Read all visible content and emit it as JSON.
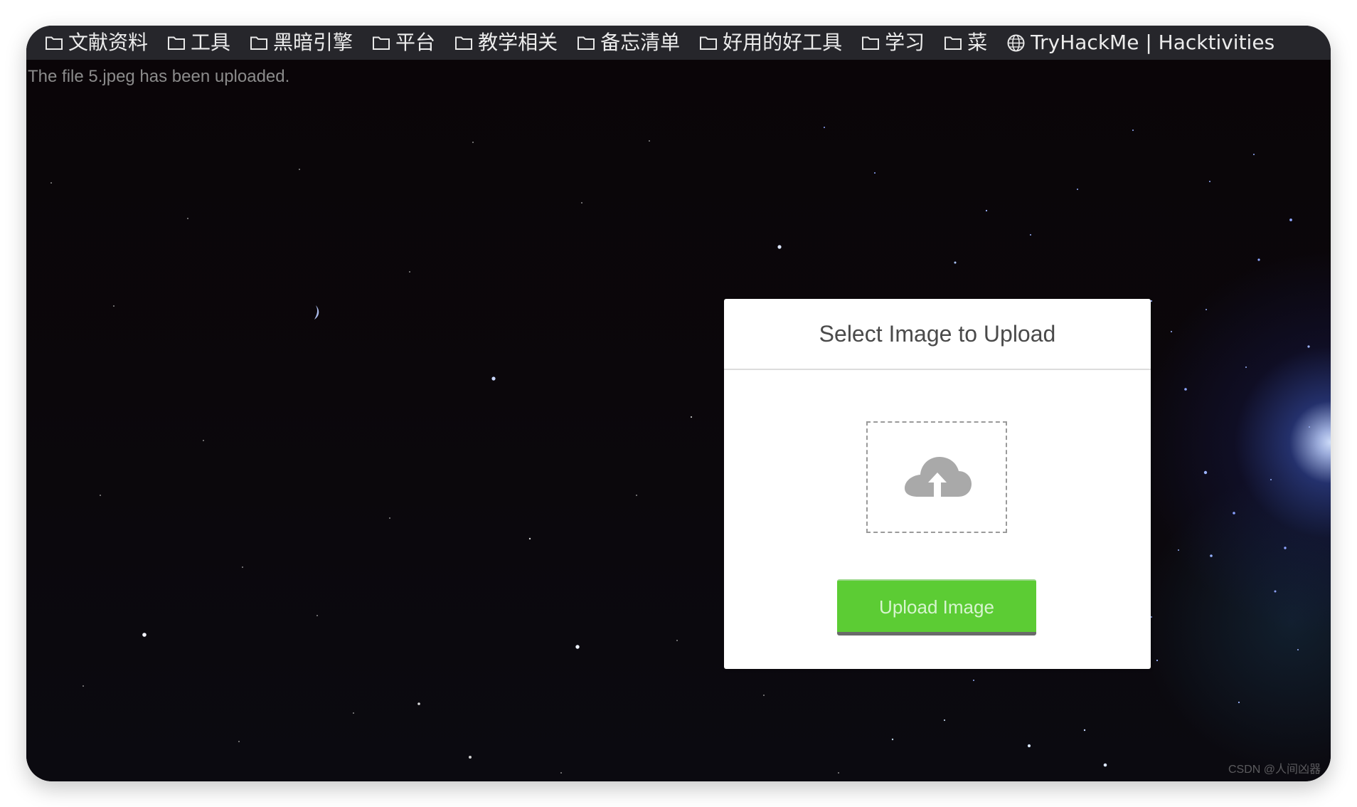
{
  "bookmarks": [
    {
      "label": "文献资料",
      "icon": "folder-icon"
    },
    {
      "label": "工具",
      "icon": "folder-icon"
    },
    {
      "label": "黑暗引擎",
      "icon": "folder-icon"
    },
    {
      "label": "平台",
      "icon": "folder-icon"
    },
    {
      "label": "教学相关",
      "icon": "folder-icon"
    },
    {
      "label": "备忘清单",
      "icon": "folder-icon"
    },
    {
      "label": "好用的好工具",
      "icon": "folder-icon"
    },
    {
      "label": "学习",
      "icon": "folder-icon"
    },
    {
      "label": "菜",
      "icon": "folder-icon"
    },
    {
      "label": "TryHackMe | Hacktivities",
      "icon": "globe-icon"
    }
  ],
  "page": {
    "notice": "The file 5.jpeg has been uploaded."
  },
  "upload": {
    "title": "Select Image to Upload",
    "icon": "cloud-upload-icon",
    "button_label": "Upload Image"
  },
  "watermark": "CSDN @人间凶器",
  "colors": {
    "bookmark_bar": "#26262b",
    "page_background": "#0a0609",
    "button": "#5ccc34",
    "card_background": "#ffffff",
    "notice_text": "#8b8b8b"
  }
}
